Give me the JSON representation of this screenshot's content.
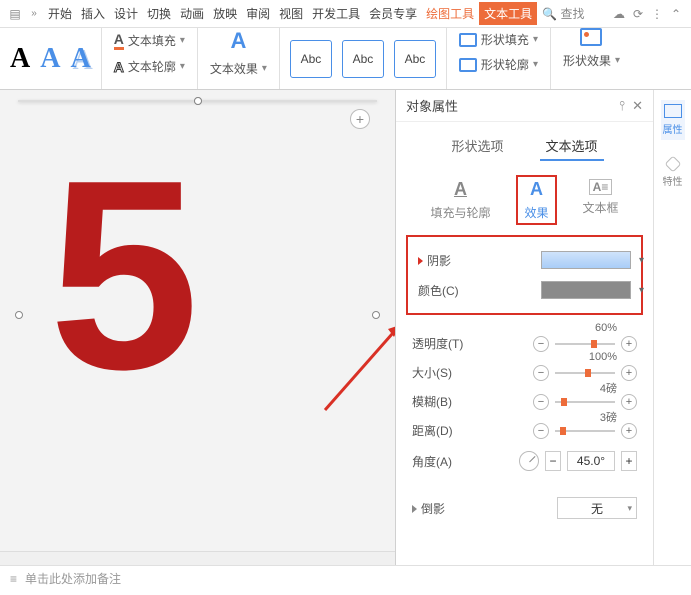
{
  "menu": {
    "home": "开始",
    "insert": "插入",
    "design": "设计",
    "transition": "切换",
    "anim": "动画",
    "slideshow": "放映",
    "review": "审阅",
    "view": "视图",
    "dev": "开发工具",
    "vip": "会员专享",
    "draw": "绘图工具",
    "text": "文本工具",
    "find": "查找"
  },
  "ribbon": {
    "text_fill": "文本填充",
    "text_outline": "文本轮廓",
    "text_effect": "文本效果",
    "abc": "Abc",
    "shape_fill": "形状填充",
    "shape_outline": "形状轮廓",
    "shape_effect": "形状效果"
  },
  "canvas": {
    "glyph": "5"
  },
  "notes": {
    "placeholder": "单击此处添加备注"
  },
  "panel": {
    "title": "对象属性",
    "tabs": {
      "shape": "形状选项",
      "text": "文本选项"
    },
    "subtabs": {
      "fill": "填充与轮廓",
      "effect": "效果",
      "textbox": "文本框"
    },
    "sections": {
      "shadow": "阴影",
      "color": "颜色(C)",
      "opacity": "透明度(T)",
      "opacity_val": "60%",
      "size": "大小(S)",
      "size_val": "100%",
      "blur": "模糊(B)",
      "blur_val": "4磅",
      "distance": "距离(D)",
      "distance_val": "3磅",
      "angle": "角度(A)",
      "angle_val": "45.0°",
      "reflection": "倒影",
      "reflection_val": "无"
    }
  },
  "side": {
    "props": "属性",
    "special": "特性"
  }
}
